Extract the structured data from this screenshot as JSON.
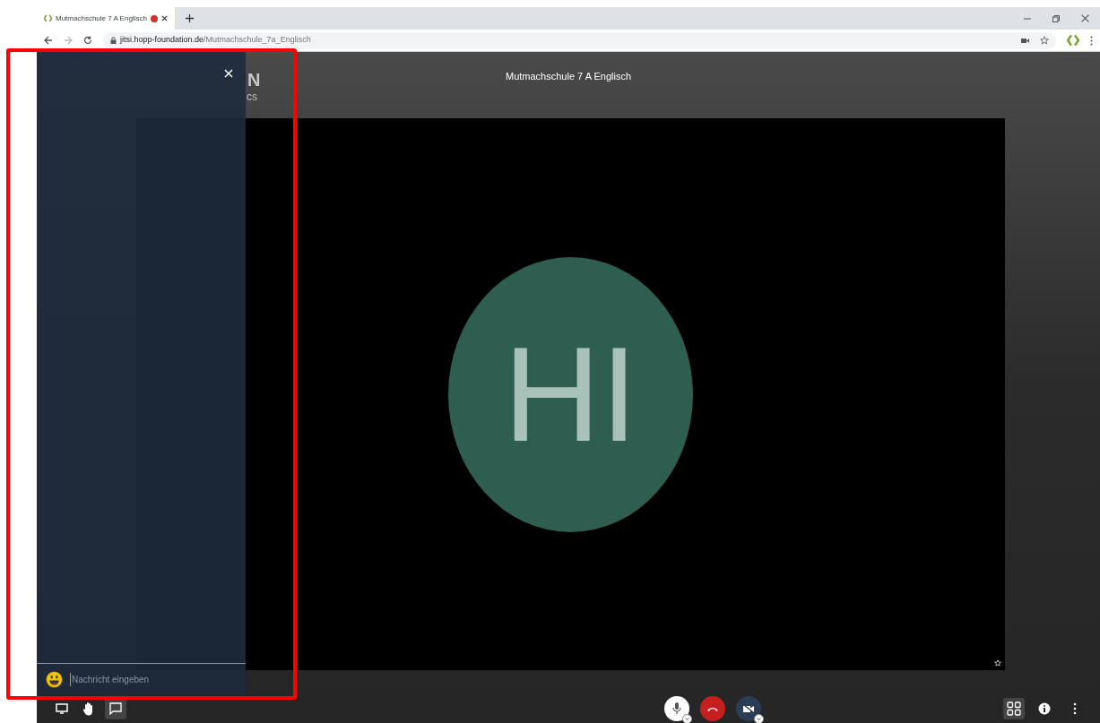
{
  "browser": {
    "tab_title": "Mutmachschule 7 A Englisch",
    "recording": true,
    "url_host": "jitsi.hopp-foundation.de",
    "url_path": "/Mutmachschule_7a_Englisch"
  },
  "logo": {
    "name": "N",
    "tagline": "cs"
  },
  "conference": {
    "title": "Mutmachschule 7 A Englisch"
  },
  "participant": {
    "initials": "HI"
  },
  "chat": {
    "open": true,
    "placeholder": "Nachricht eingeben"
  },
  "toolbar_left": [
    {
      "kind": "screen",
      "selected": false
    },
    {
      "kind": "hand",
      "selected": false
    },
    {
      "kind": "chat",
      "selected": true
    }
  ],
  "toolbar_right": [
    {
      "kind": "tiles",
      "selected": true
    },
    {
      "kind": "info",
      "selected": false
    },
    {
      "kind": "more",
      "selected": false
    }
  ],
  "highlight": true
}
